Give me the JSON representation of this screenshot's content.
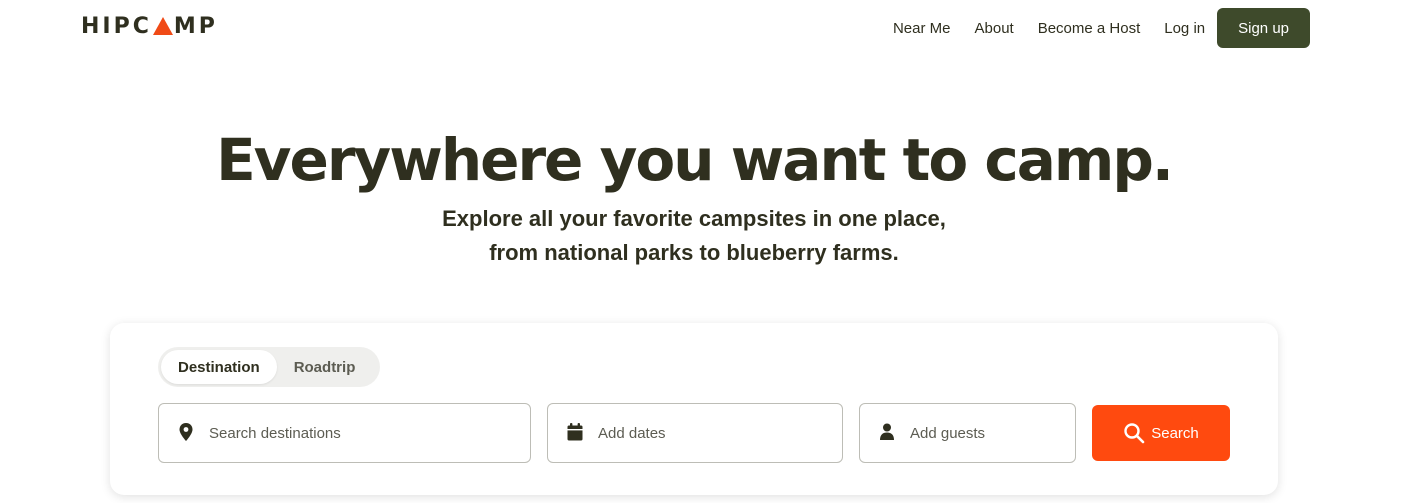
{
  "brand": {
    "logo_text_left": "HIPC",
    "logo_text_right": "MP",
    "accent_color": "#f04a16"
  },
  "nav": {
    "items": [
      {
        "label": "Near Me"
      },
      {
        "label": "About"
      },
      {
        "label": "Become a Host"
      },
      {
        "label": "Log in"
      }
    ],
    "signup_label": "Sign up",
    "signup_color": "#3e4a2b"
  },
  "hero": {
    "title": "Everywhere you want to camp.",
    "subtitle_line1": "Explore all your favorite campsites in one place,",
    "subtitle_line2": "from national parks to blueberry farms."
  },
  "search": {
    "tabs": [
      {
        "label": "Destination",
        "active": true
      },
      {
        "label": "Roadtrip",
        "active": false
      }
    ],
    "destination": {
      "placeholder": "Search destinations",
      "icon": "map-pin-icon"
    },
    "dates": {
      "placeholder": "Add dates",
      "icon": "calendar-icon"
    },
    "guests": {
      "placeholder": "Add guests",
      "icon": "person-icon"
    },
    "button_label": "Search",
    "button_icon": "search-icon",
    "button_color": "#ff4a0f"
  }
}
